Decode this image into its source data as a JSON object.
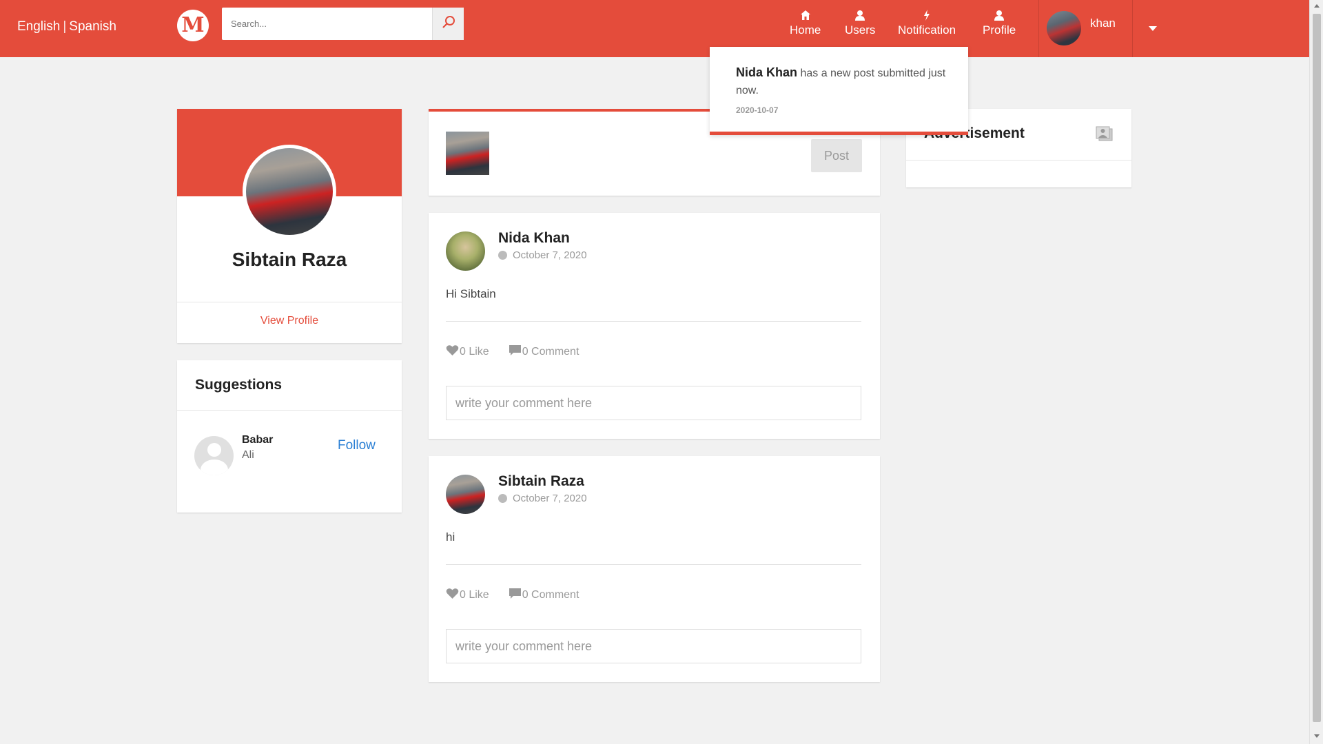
{
  "topbar": {
    "languages": [
      "English",
      "Spanish"
    ],
    "language_separator": "|",
    "logo_letter": "M",
    "search_placeholder": "Search...",
    "nav": [
      {
        "label": "Home",
        "icon": "home-icon"
      },
      {
        "label": "Users",
        "icon": "users-icon"
      },
      {
        "label": "Notification",
        "icon": "bolt-icon"
      },
      {
        "label": "Profile",
        "icon": "profile-icon"
      }
    ],
    "user_name": "khan",
    "brand_color": "#e44c3b"
  },
  "notification_popup": {
    "who": "Nida Khan",
    "message": "has a new post submitted just now.",
    "date": "2020-10-07"
  },
  "profile": {
    "name": "Sibtain Raza",
    "view_profile_label": "View Profile"
  },
  "suggestions": {
    "title": "Suggestions",
    "items": [
      {
        "first_name": "Babar",
        "last_name": "Ali",
        "action_label": "Follow"
      }
    ]
  },
  "create_post": {
    "post_button_label": "Post"
  },
  "posts": [
    {
      "author": "Nida Khan",
      "date": "October 7, 2020",
      "text": "Hi Sibtain",
      "likes_label": "0 Like",
      "comments_label": "0 Comment",
      "comment_placeholder": "write your comment here"
    },
    {
      "author": "Sibtain Raza",
      "date": "October 7, 2020",
      "text": "hi",
      "likes_label": "0 Like",
      "comments_label": "0 Comment",
      "comment_placeholder": "write your comment here"
    }
  ],
  "advertisement": {
    "title": "Advertisement",
    "icon": "images-icon"
  }
}
